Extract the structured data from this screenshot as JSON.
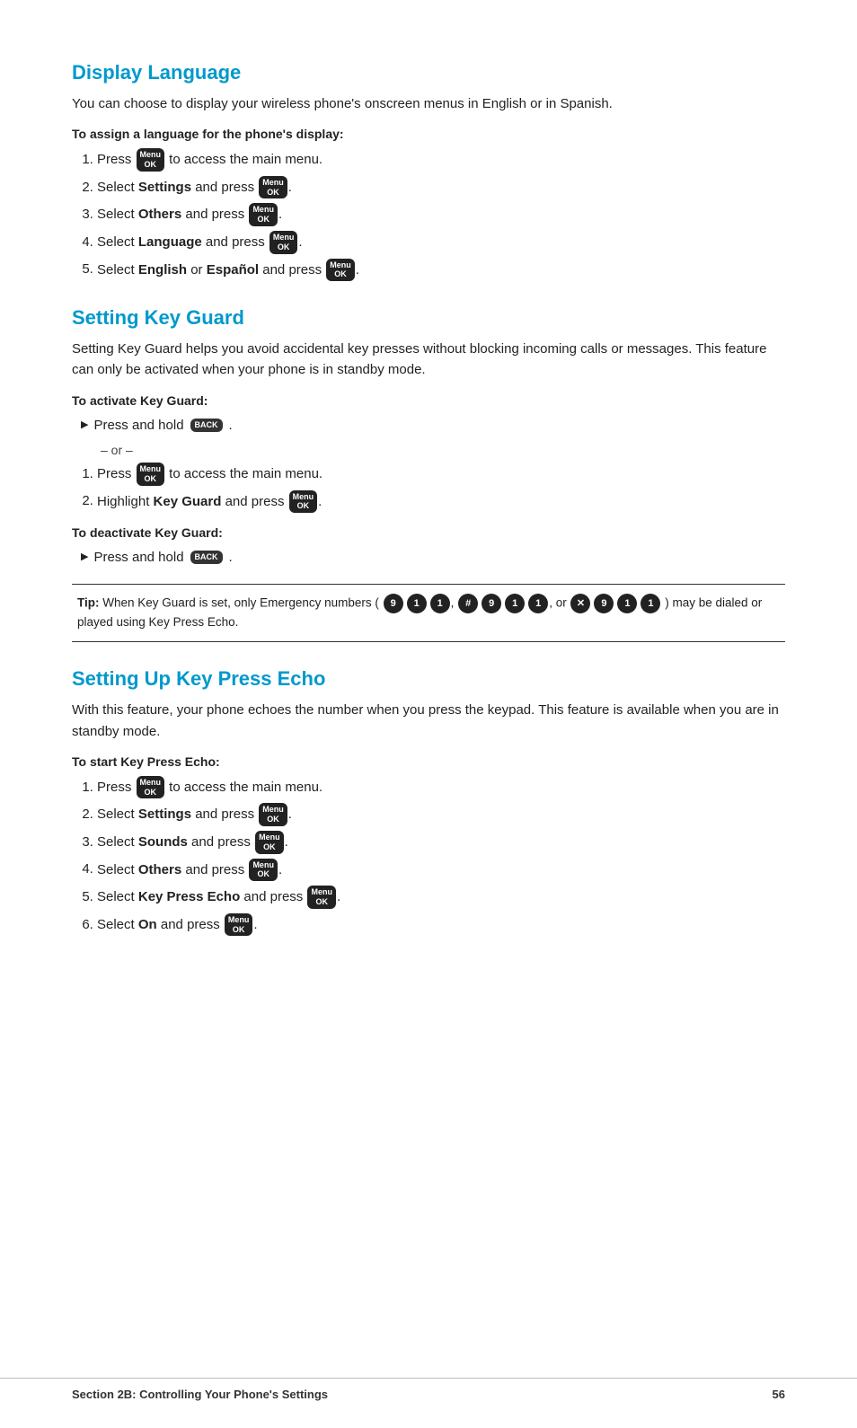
{
  "sections": [
    {
      "id": "display-language",
      "title": "Display Language",
      "intro": "You can choose to display your wireless phone's onscreen menus in English or in Spanish.",
      "subsections": [
        {
          "heading": "To assign a language for the phone's display:",
          "type": "ordered",
          "items": [
            {
              "text_before": "Press ",
              "key": "menu",
              "text_after": " to access the main menu."
            },
            {
              "text_before": "Select ",
              "bold": "Settings",
              "text_middle": " and press ",
              "key": "menu",
              "text_after": "."
            },
            {
              "text_before": "Select ",
              "bold": "Others",
              "text_middle": " and press ",
              "key": "menu",
              "text_after": "."
            },
            {
              "text_before": "Select ",
              "bold": "Language",
              "text_middle": " and press ",
              "key": "menu",
              "text_after": "."
            },
            {
              "text_before": "Select ",
              "bold": "English",
              "text_middle": " or ",
              "bold2": "Español",
              "text_middle2": " and press ",
              "key": "menu",
              "text_after": "."
            }
          ]
        }
      ]
    },
    {
      "id": "setting-key-guard",
      "title": "Setting Key Guard",
      "intro": "Setting Key Guard helps you avoid accidental key presses without blocking incoming calls or messages. This feature can only be activated when your phone is in standby mode.",
      "subsections": [
        {
          "heading": "To activate Key Guard:",
          "type": "bullet",
          "items": [
            {
              "text_before": "Press and hold ",
              "key": "back",
              "text_after": "."
            }
          ]
        },
        {
          "type": "or"
        },
        {
          "type": "ordered",
          "items": [
            {
              "text_before": "Press ",
              "key": "menu",
              "text_after": " to access the main menu."
            },
            {
              "text_before": "Highlight ",
              "bold": "Key Guard",
              "text_middle": " and press ",
              "key": "menu",
              "text_after": "."
            }
          ]
        },
        {
          "heading": "To deactivate Key Guard:",
          "type": "bullet",
          "items": [
            {
              "text_before": "Press and hold ",
              "key": "back",
              "text_after": "."
            }
          ]
        }
      ]
    },
    {
      "id": "tip-box",
      "tip_label": "Tip:",
      "tip_text": " When Key Guard is set, only Emergency numbers (",
      "tip_keys_1": [
        "9",
        "1",
        "1"
      ],
      "tip_sep1": ",",
      "tip_keys_2": [
        "#",
        "9",
        "1",
        "1"
      ],
      "tip_sep2": ", or",
      "tip_keys_3": [
        "×",
        "9",
        "1",
        "1"
      ],
      "tip_end": ") may be dialed or played using Key Press Echo."
    },
    {
      "id": "setting-up-key-press-echo",
      "title": "Setting Up Key Press Echo",
      "intro": "With this feature, your phone echoes the number when you press the keypad. This feature is available when you are in standby mode.",
      "subsections": [
        {
          "heading": "To start Key Press Echo:",
          "type": "ordered",
          "items": [
            {
              "text_before": "Press ",
              "key": "menu",
              "text_after": " to access the main menu."
            },
            {
              "text_before": "Select ",
              "bold": "Settings",
              "text_middle": " and press ",
              "key": "menu",
              "text_after": "."
            },
            {
              "text_before": "Select ",
              "bold": "Sounds",
              "text_middle": " and press ",
              "key": "menu",
              "text_after": "."
            },
            {
              "text_before": "Select ",
              "bold": "Others",
              "text_middle": " and press ",
              "key": "menu",
              "text_after": "."
            },
            {
              "text_before": "Select ",
              "bold": "Key Press Echo",
              "text_middle": " and press ",
              "key": "menu",
              "text_after": "."
            },
            {
              "text_before": "Select ",
              "bold": "On",
              "text_middle": " and press ",
              "key": "menu",
              "text_after": "."
            }
          ]
        }
      ]
    }
  ],
  "footer": {
    "left": "Section 2B: Controlling Your Phone's Settings",
    "right": "56"
  }
}
